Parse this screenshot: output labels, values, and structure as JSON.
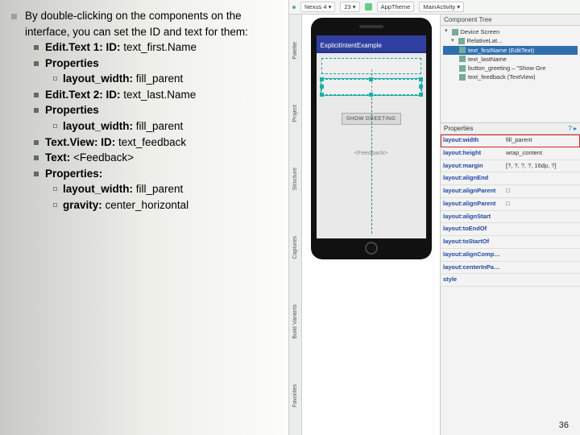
{
  "slide": {
    "intro": "By double-clicking on the components on the interface, you can set the ID and text  for them:",
    "items": [
      {
        "level": 1,
        "html": "<b>Edit.Text 1: ID:</b> text_first.Name"
      },
      {
        "level": 1,
        "html": "<b>Properties</b>"
      },
      {
        "level": 2,
        "html": "<b>layout_width:</b> fill_parent"
      },
      {
        "level": 1,
        "html": "<b>Edit.Text 2: ID:</b> text_last.Name"
      },
      {
        "level": 1,
        "html": "<b>Properties</b>"
      },
      {
        "level": 2,
        "html": "<b>layout_width:</b> fill_parent"
      },
      {
        "level": 1,
        "html": "<b>Text.View: ID:</b> text_feedback"
      },
      {
        "level": 1,
        "html": "<b>Text:</b> &lt;Feedback&gt;"
      },
      {
        "level": 1,
        "html": "<b>Properties:</b>"
      },
      {
        "level": 2,
        "html": "<b>layout_width:</b> fill_parent"
      },
      {
        "level": 2,
        "html": "<b>gravity:</b> center_horizontal"
      }
    ]
  },
  "ide": {
    "topbar": {
      "device": "Nexus 4 ▾",
      "api": "23 ▾",
      "theme": "AppTheme",
      "activity": "MainActivity ▾"
    },
    "vtabs": [
      "Palette",
      "Project",
      "Structure",
      "Captures",
      "Build Variants",
      "Favorites"
    ],
    "phone": {
      "app_title": "ExplicitIntentExample",
      "button_label": "SHOW GREETING",
      "feedback_text": "<Feedback>"
    },
    "componentTree": {
      "title": "Component Tree",
      "root": "Device Screen",
      "layout": "RelativeLat...",
      "children": [
        {
          "label": "text_firstName (EditText)",
          "selected": true
        },
        {
          "label": "text_lastName"
        },
        {
          "label": "button_greeting – \"Show Gre"
        },
        {
          "label": "text_feedback (TextView)"
        }
      ]
    },
    "properties": {
      "title": "Properties",
      "hint": "?  ▸",
      "rows": [
        {
          "k": "layout:width",
          "v": "fill_parent",
          "hl": true
        },
        {
          "k": "layout:height",
          "v": "wrap_content"
        },
        {
          "k": "layout:margin",
          "v": "[?, ?, ?, ?, 16dp, ?]"
        },
        {
          "k": "layout:alignEnd",
          "v": ""
        },
        {
          "k": "layout:alignParent",
          "v": "□"
        },
        {
          "k": "layout:alignParent",
          "v": "□"
        },
        {
          "k": "layout:alignStart",
          "v": ""
        },
        {
          "k": "layout:toEndOf",
          "v": ""
        },
        {
          "k": "layout:toStartOf",
          "v": ""
        },
        {
          "k": "layout:alignComp [ ]",
          "v": ""
        },
        {
          "k": "layout:centerInPa horizontal",
          "v": ""
        },
        {
          "k": "style",
          "v": ""
        }
      ]
    }
  },
  "page_number": "36"
}
